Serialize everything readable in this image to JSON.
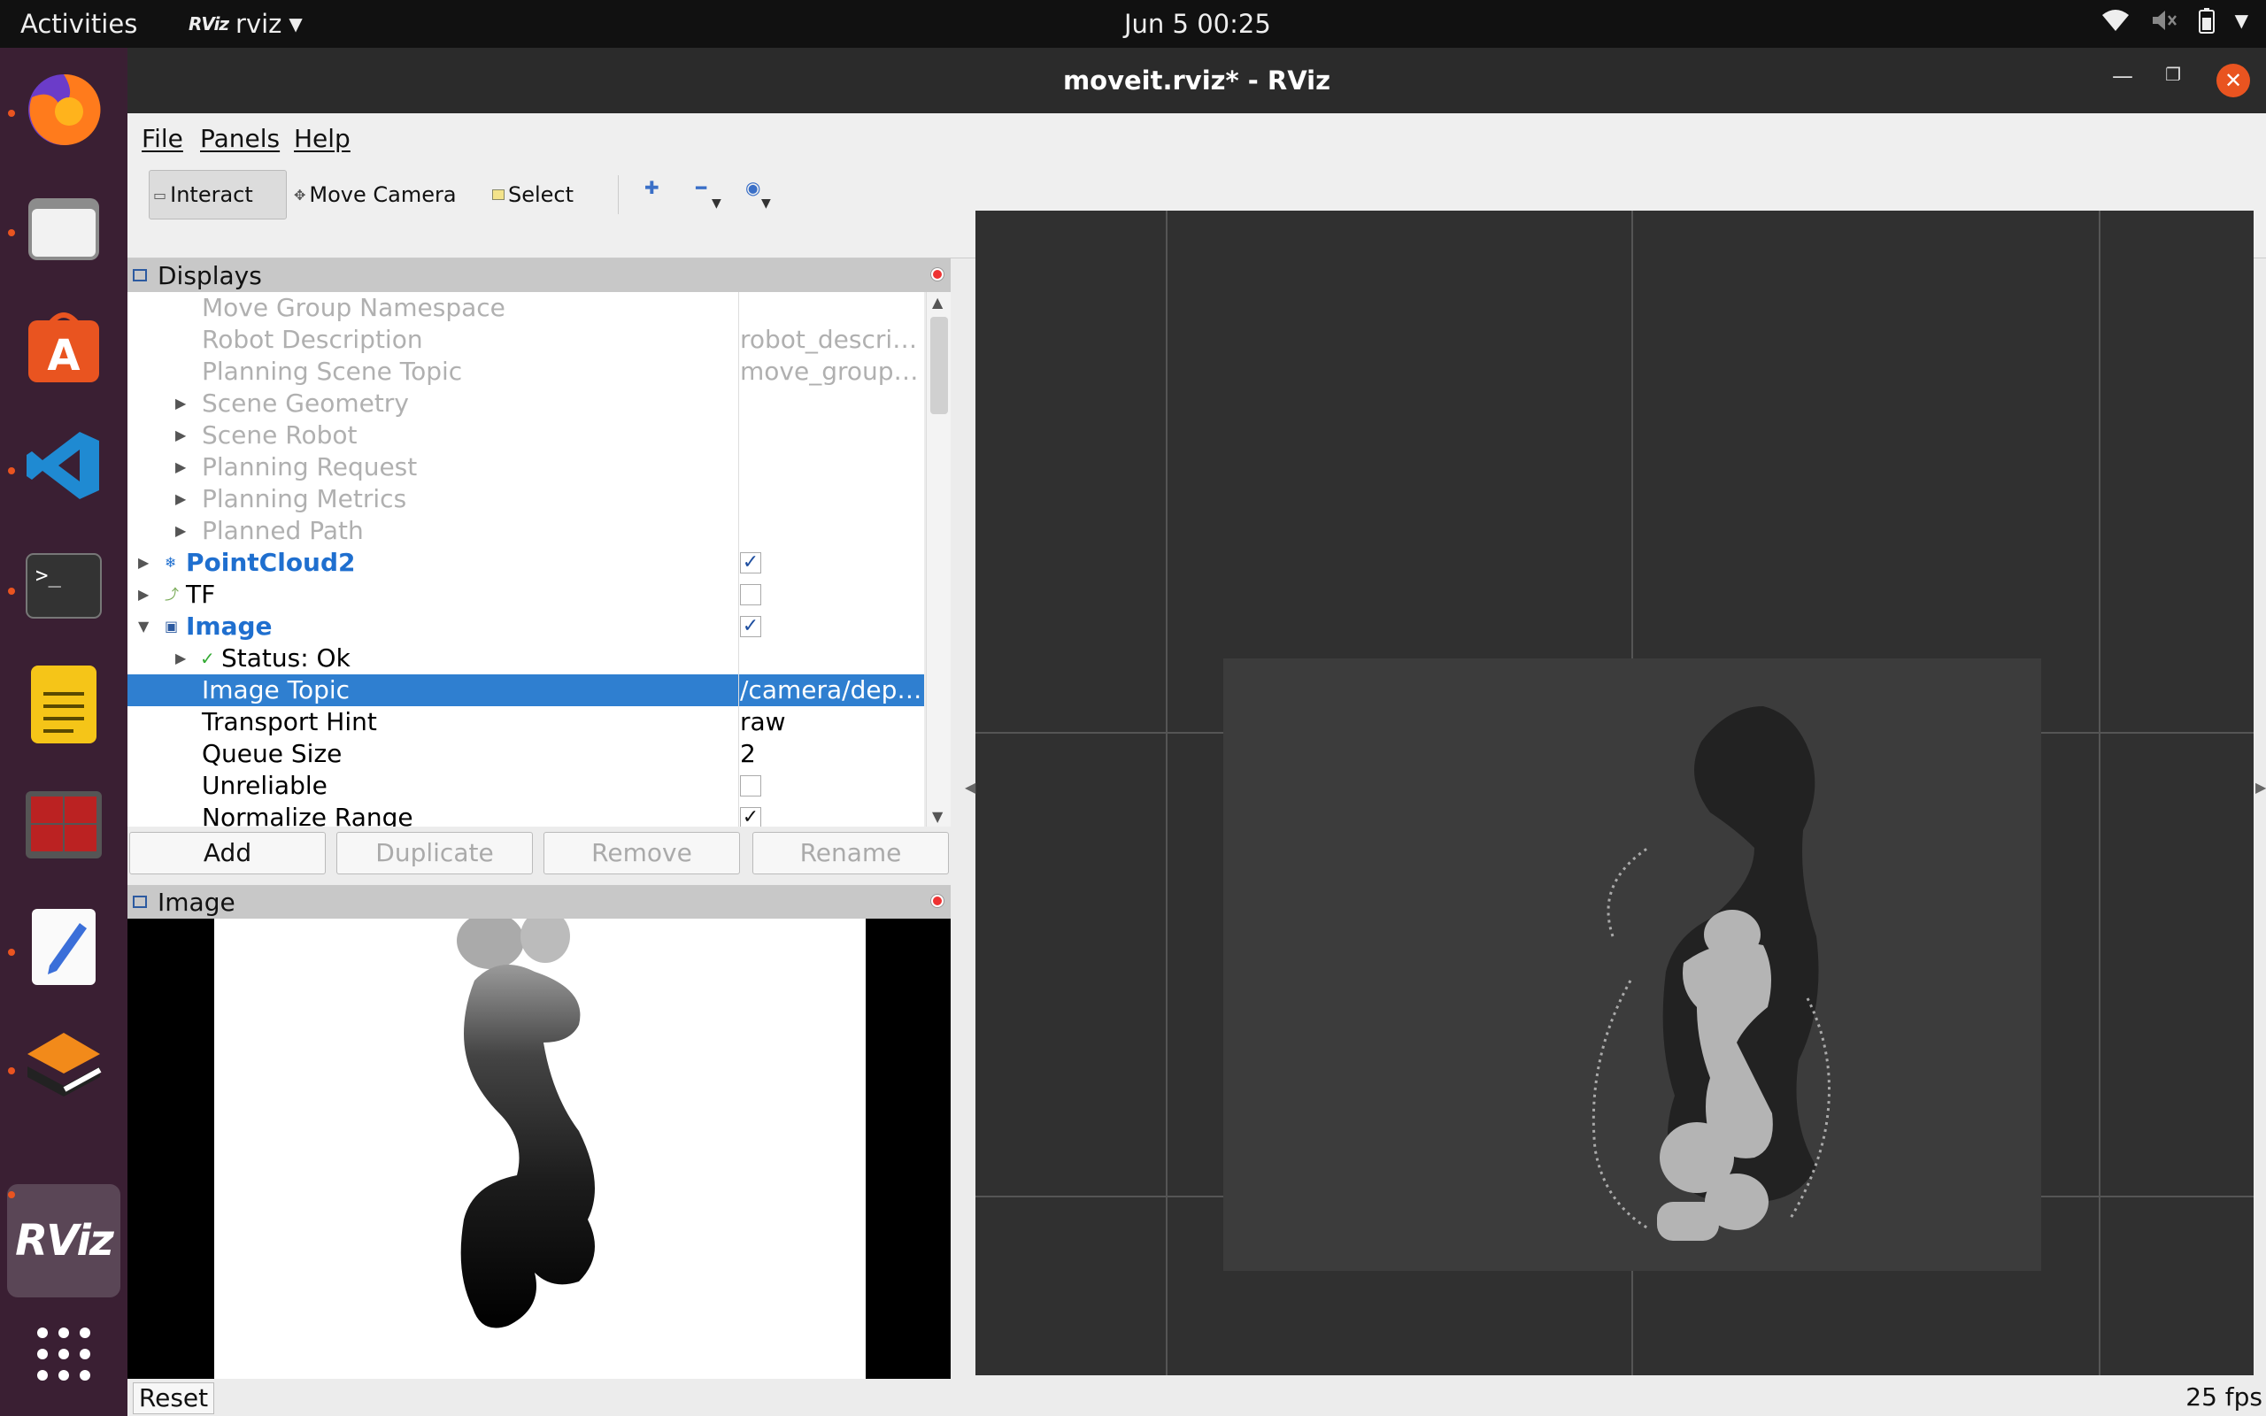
{
  "topbar": {
    "activities": "Activities",
    "app_logo": "RViz",
    "app_name": "rviz",
    "clock": "Jun 5  00:25",
    "tray_icons": [
      "wifi-icon",
      "volume-muted-icon",
      "battery-icon",
      "power-menu-icon"
    ]
  },
  "dock": {
    "apps": [
      "firefox",
      "files",
      "software-center",
      "vscode",
      "terminal",
      "notes",
      "terminator",
      "text-editor",
      "gazebo",
      "rviz"
    ],
    "rviz_label": "RViz"
  },
  "window": {
    "title": "moveit.rviz* - RViz"
  },
  "menubar": {
    "file": "File",
    "panels": "Panels",
    "help": "Help"
  },
  "toolbar": {
    "interact": "Interact",
    "move_camera": "Move Camera",
    "select": "Select"
  },
  "displays": {
    "title": "Displays",
    "rows": [
      {
        "label": "Move Group Namespace",
        "value": ""
      },
      {
        "label": "Robot Description",
        "value": "robot_descri…"
      },
      {
        "label": "Planning Scene Topic",
        "value": "move_group/…"
      },
      {
        "label": "Scene Geometry",
        "value": ""
      },
      {
        "label": "Scene Robot",
        "value": ""
      },
      {
        "label": "Planning Request",
        "value": ""
      },
      {
        "label": "Planning Metrics",
        "value": ""
      },
      {
        "label": "Planned Path",
        "value": ""
      },
      {
        "label": "PointCloud2",
        "value": ""
      },
      {
        "label": "TF",
        "value": ""
      },
      {
        "label": "Image",
        "value": ""
      },
      {
        "label": "Status: Ok",
        "value": ""
      },
      {
        "label": "Image Topic",
        "value": "/camera/dep…"
      },
      {
        "label": "Transport Hint",
        "value": "raw"
      },
      {
        "label": "Queue Size",
        "value": "2"
      },
      {
        "label": "Unreliable",
        "value": ""
      },
      {
        "label": "Normalize Range",
        "value": ""
      }
    ],
    "checks": {
      "pointcloud2": true,
      "tf": false,
      "image": true,
      "unreliable": false,
      "normalize_range": true
    },
    "buttons": {
      "add": "Add",
      "duplicate": "Duplicate",
      "remove": "Remove",
      "rename": "Rename"
    }
  },
  "image_panel": {
    "title": "Image"
  },
  "statusbar": {
    "reset": "Reset",
    "fps": "25 fps"
  },
  "colors": {
    "accent": "#e95420",
    "selection": "#2f7fd0",
    "dock_bg": "#3a1f33"
  }
}
